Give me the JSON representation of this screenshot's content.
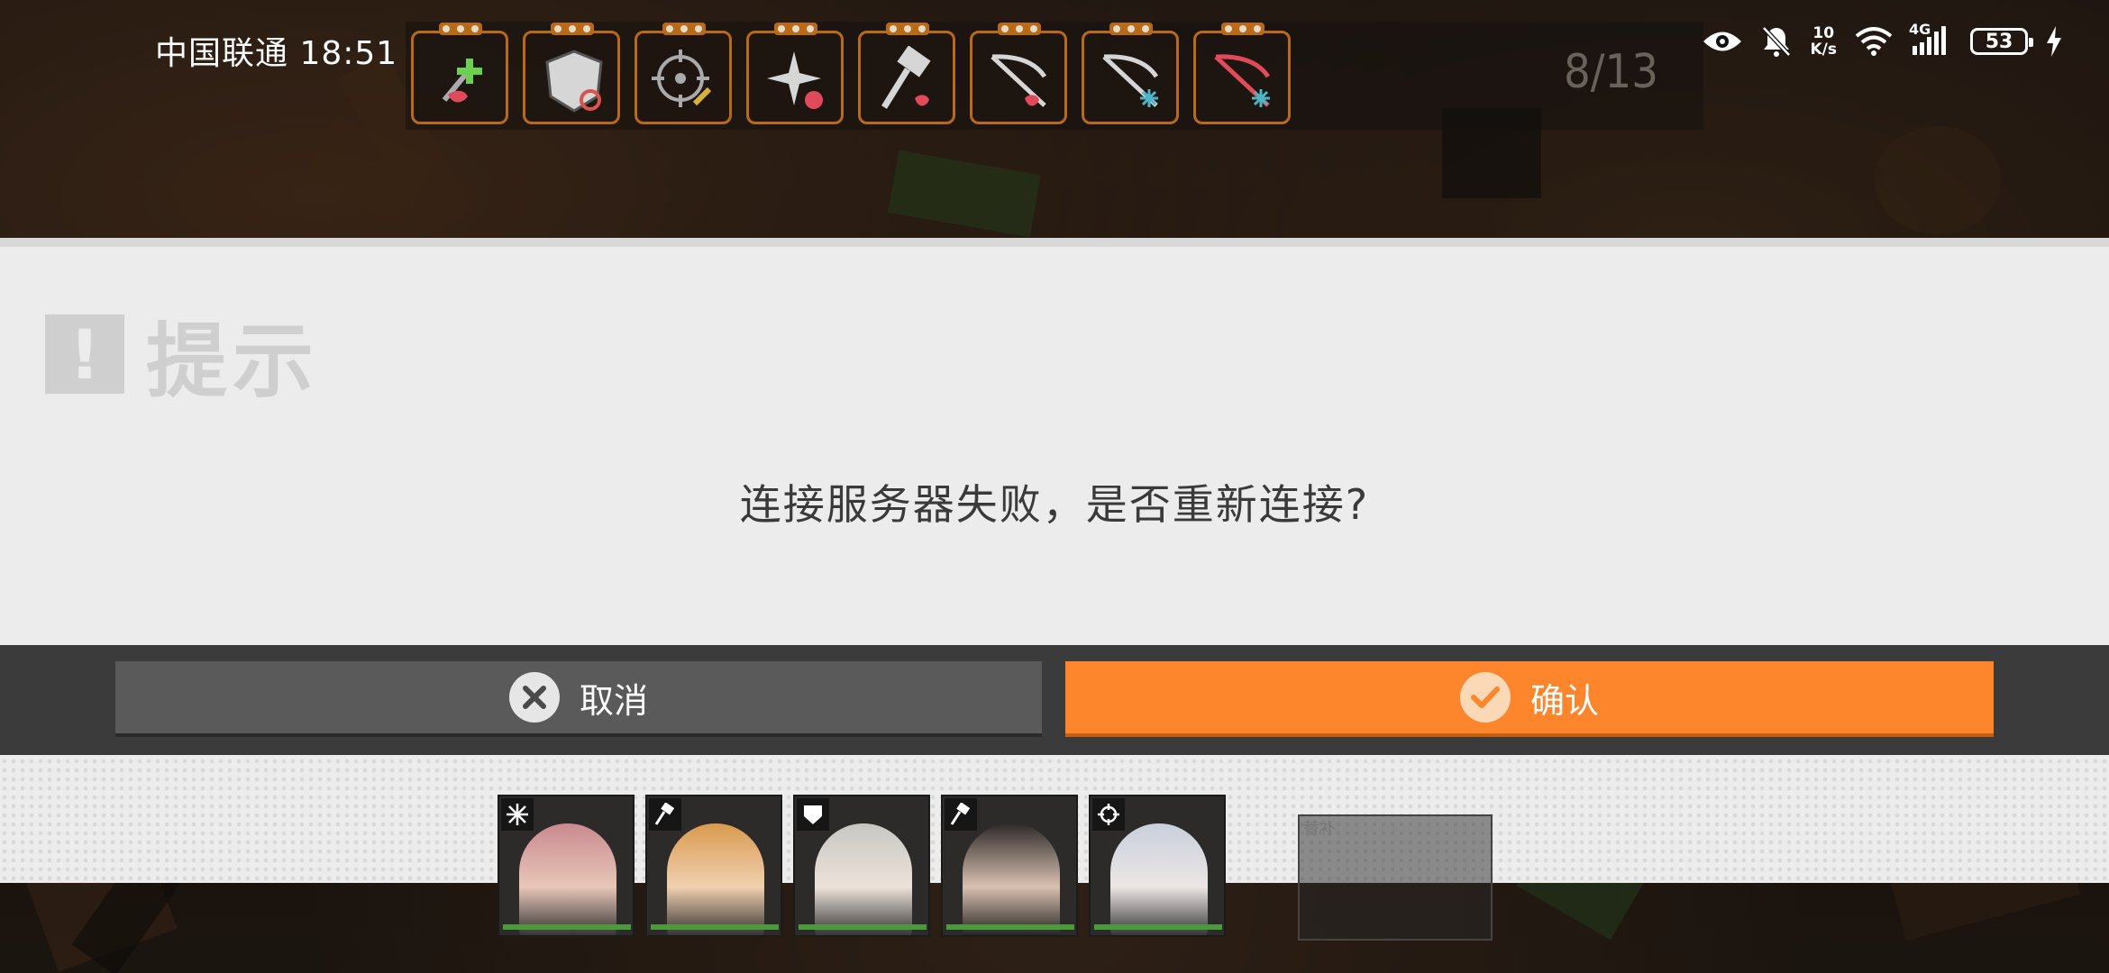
{
  "status_bar": {
    "carrier_time": "中国联通 18:51",
    "net_speed_value": "10",
    "net_speed_unit": "K/s",
    "network_type": "4G",
    "battery": "53",
    "icons": [
      "eye-icon",
      "bell-off-icon",
      "wifi-icon",
      "signal-icon",
      "battery-icon",
      "charging-icon"
    ]
  },
  "skill_bar": {
    "count": "8/13",
    "skills": [
      {
        "name": "heal-skill-icon",
        "accent": "#e04a5a"
      },
      {
        "name": "shield-skill-icon",
        "accent": "#d9534f"
      },
      {
        "name": "target-skill-icon",
        "accent": "#d8b13a"
      },
      {
        "name": "star-skill-icon",
        "accent": "#e04a5a"
      },
      {
        "name": "hammer-skill-icon",
        "accent": "#e04a5a"
      },
      {
        "name": "crossbow-skill-icon",
        "accent": "#e04a5a"
      },
      {
        "name": "crossbow-frost-skill-icon",
        "accent": "#4ab7c8"
      },
      {
        "name": "crossbow-red-skill-icon",
        "accent": "#e04a5a"
      }
    ]
  },
  "dialog": {
    "title": "提示",
    "message": "连接服务器失败，是否重新连接?",
    "cancel_label": "取消",
    "confirm_label": "确认"
  },
  "team": {
    "members": [
      {
        "class_icon": "snowflake-class-icon",
        "hair": "#c98a8f"
      },
      {
        "class_icon": "hammer-class-icon",
        "hair": "#d99a4f"
      },
      {
        "class_icon": "shield-class-icon",
        "hair": "#c7c7c2"
      },
      {
        "class_icon": "hammer-class-icon",
        "hair": "#2e2a2a"
      },
      {
        "class_icon": "crosshair-class-icon",
        "hair": "#c9cfdc"
      }
    ],
    "substitute_label": "替补"
  },
  "colors": {
    "confirm": "#fd852c",
    "cancel": "#5a5a5a",
    "dialog_bg": "#ececec"
  }
}
